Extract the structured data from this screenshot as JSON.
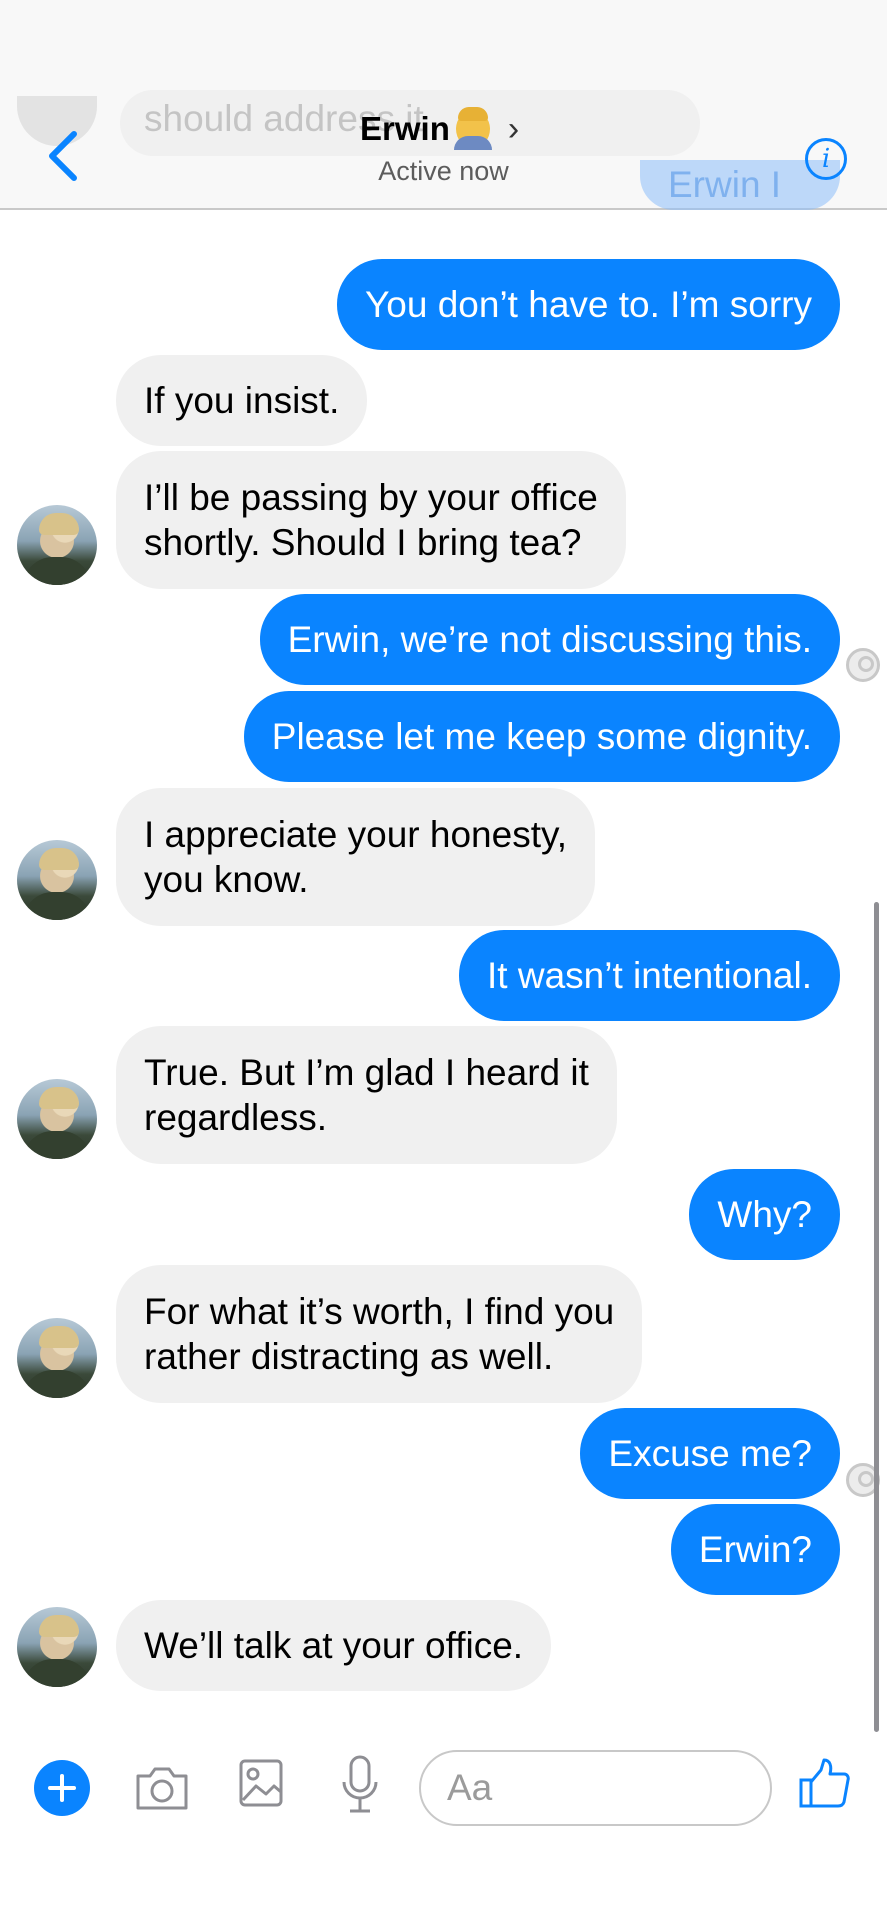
{
  "header": {
    "contact_name": "Erwin",
    "status": "Active now",
    "clipped_incoming_text": "should address it",
    "clipped_outgoing_text": "Erwin I—"
  },
  "messages": [
    {
      "from": "me",
      "text": "You don’t have to. I’m sorry"
    },
    {
      "from": "erwin",
      "text": "If you insist."
    },
    {
      "from": "erwin",
      "lines": [
        "I’ll be passing by your office",
        "shortly. Should I bring tea?"
      ]
    },
    {
      "from": "me",
      "text": "Erwin, we’re not discussing this."
    },
    {
      "from": "me",
      "text": "Please let me keep some dignity."
    },
    {
      "from": "erwin",
      "lines": [
        "I appreciate your honesty,",
        "you know."
      ]
    },
    {
      "from": "me",
      "text": "It wasn’t intentional."
    },
    {
      "from": "erwin",
      "lines": [
        "True. But I’m glad I heard it",
        "regardless."
      ]
    },
    {
      "from": "me",
      "text": "Why?"
    },
    {
      "from": "erwin",
      "lines": [
        "For what it’s worth, I find you",
        "rather distracting as well."
      ]
    },
    {
      "from": "me",
      "text": "Excuse me?"
    },
    {
      "from": "me",
      "text": "Erwin?"
    },
    {
      "from": "erwin",
      "text": "We’ll talk at your office."
    }
  ],
  "composer": {
    "placeholder": "Aa",
    "icons": [
      "plus-icon",
      "camera-icon",
      "image-icon",
      "microphone-icon",
      "thumbs-up-icon"
    ]
  },
  "colors": {
    "outgoing_bubble": "#0a84ff",
    "incoming_bubble": "#f0f0f0",
    "accent": "#0a84ff"
  }
}
